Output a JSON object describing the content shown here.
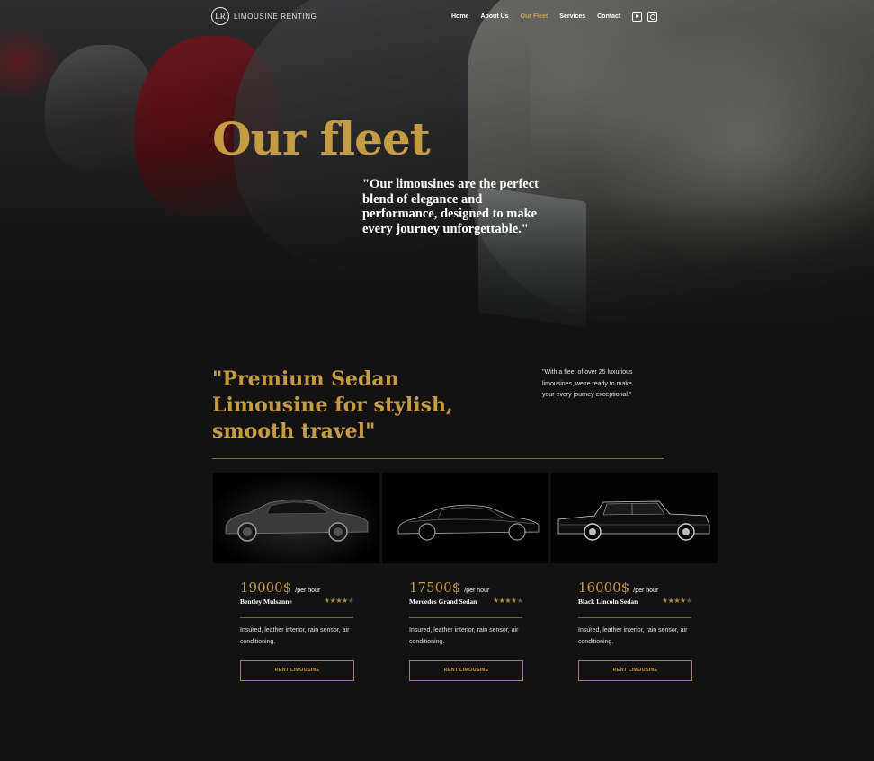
{
  "header": {
    "logo_mark": "LR",
    "logo_text": "LIMOUSINE RENTING",
    "nav": [
      {
        "label": "Home",
        "active": false
      },
      {
        "label": "About Us",
        "active": false
      },
      {
        "label": "Our Fleet",
        "active": true
      },
      {
        "label": "Services",
        "active": false
      },
      {
        "label": "Contact",
        "active": false
      }
    ],
    "social_icons": [
      "youtube-icon",
      "instagram-icon"
    ]
  },
  "hero": {
    "title": "Our fleet",
    "quote": "\"Our limousines are the perfect blend of elegance and performance, designed to make every journey unforgettable.\""
  },
  "section": {
    "title": "\"Premium Sedan Limousine for stylish, smooth travel\"",
    "note": "\"With a fleet of over 25 luxurious limousines, we're ready to make your every journey exceptional.\""
  },
  "cars": [
    {
      "price": "19000$",
      "unit": "/per hour",
      "name": "Bentley Mulsanne",
      "rating": 4,
      "rating_max": 5,
      "description": "Insured, leather interior, rain sensor, air conditioning.",
      "button": "RENT LIMOUSINE"
    },
    {
      "price": "17500$",
      "unit": "/per hour",
      "name": "Mercedes Grand Sedan",
      "rating": 4,
      "rating_max": 5,
      "description": "Insured, leather interior, rain sensor, air conditioning.",
      "button": "RENT LIMOUSINE"
    },
    {
      "price": "16000$",
      "unit": "/per hour",
      "name": "Black Lincoln Sedan",
      "rating": 4,
      "rating_max": 5,
      "description": "Insured, leather interior, rain sensor, air conditioning.",
      "button": "RENT LIMOUSINE"
    }
  ],
  "colors": {
    "accent": "#c59b44",
    "background": "#121212"
  }
}
